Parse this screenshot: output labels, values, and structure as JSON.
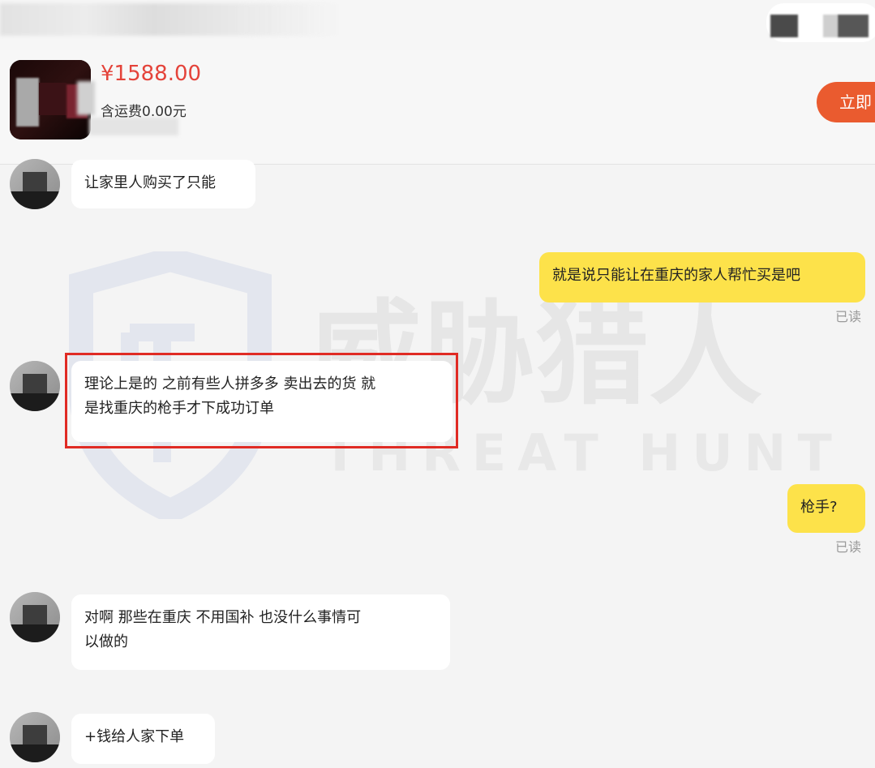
{
  "header": {
    "title": ""
  },
  "product": {
    "price": "¥1588.00",
    "shipping": "含运费0.00元",
    "buy_label": "立即"
  },
  "watermark": {
    "cn_text": "威胁猎人",
    "en_text": "THREAT HUNTER"
  },
  "messages": [
    {
      "side": "left",
      "text": "让家里人购买了只能"
    },
    {
      "side": "right",
      "text": "就是说只能让在重庆的家人帮忙买是吧",
      "status": "已读"
    },
    {
      "side": "left",
      "text_line1": "理论上是的 之前有些人拼多多 卖出去的货 就",
      "text_line2": "是找重庆的枪手才下成功订单",
      "highlighted": true
    },
    {
      "side": "right",
      "text": "枪手?",
      "status": "已读"
    },
    {
      "side": "left",
      "text_line1": "对啊  那些在重庆 不用国补 也没什么事情可",
      "text_line2": "以做的"
    },
    {
      "side": "left",
      "text": "+钱给人家下单"
    }
  ],
  "colors": {
    "price_red": "#e4433a",
    "buy_orange": "#ea5b2f",
    "my_bubble_yellow": "#fde24a",
    "highlight_red": "#e02b24"
  }
}
